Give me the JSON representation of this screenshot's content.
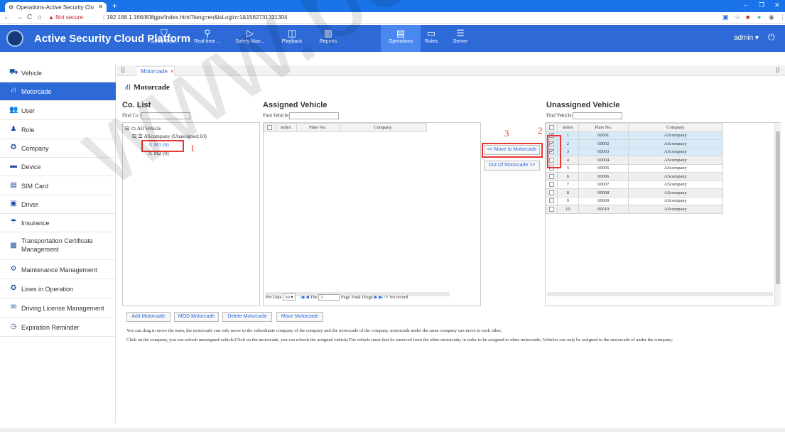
{
  "browser": {
    "tab_title": "Operations-Active Security Clo",
    "security_label": "Not secure",
    "url": "192.168.1.166/808gps/index.html?lang=en&isLogin=1&1562731331304"
  },
  "app": {
    "title": "Active Security Cloud Platform",
    "user": "admin",
    "accent": "#2d6ad8",
    "nav_tabs": [
      {
        "label": "Safety Boa...",
        "icon": "shield-icon"
      },
      {
        "label": "Real-time ...",
        "icon": "location-pin-icon"
      },
      {
        "label": "Safety Man...",
        "icon": "play-shield-icon"
      },
      {
        "label": "Playback",
        "icon": "playback-icon"
      },
      {
        "label": "Reports",
        "icon": "bar-chart-icon"
      },
      {
        "label": "Operations",
        "icon": "operations-icon"
      },
      {
        "label": "Rules",
        "icon": "rules-icon"
      },
      {
        "label": "Server",
        "icon": "server-icon"
      }
    ]
  },
  "sidebar": {
    "items": [
      {
        "label": "Vehicle"
      },
      {
        "label": "Motorcade"
      },
      {
        "label": "User"
      },
      {
        "label": "Role"
      },
      {
        "label": "Company"
      },
      {
        "label": "Device"
      },
      {
        "label": "SIM Card"
      },
      {
        "label": "Driver"
      },
      {
        "label": "Insurance"
      },
      {
        "label": "Transportation Certificate Management"
      },
      {
        "label": "Maintenance Management"
      },
      {
        "label": "Lines in Operation"
      },
      {
        "label": "Driving License Management"
      },
      {
        "label": "Expiration Reminder"
      }
    ]
  },
  "page_tab": {
    "label": "Motorcade",
    "close": "×"
  },
  "page_heading": "Motorcade",
  "co_list": {
    "title": "Co. List",
    "find_label": "Find Co.:",
    "tree": {
      "root": "All Vehicle",
      "company": "AScompany (Unassigned:10)",
      "m1": "M1 (0)",
      "m2": "M2 (0)"
    }
  },
  "assigned": {
    "title": "Assigned Vehicle",
    "find_label": "Find Vehicle:",
    "columns": [
      "Index",
      "Plate No.",
      "Company"
    ],
    "pager": {
      "per_data_label": "Per Data",
      "per_data_value": "50",
      "the_label": "The",
      "page_value": "1",
      "page_total": "Page Total 1Page",
      "status": "No record"
    }
  },
  "actions": {
    "move_to": "<< Move to Motorcade",
    "out_of": "Out Of Motorcade >>"
  },
  "unassigned": {
    "title": "Unassigned Vehicle",
    "find_label": "Find Vehicle:",
    "columns": [
      "Index",
      "Plate No.",
      "Company"
    ],
    "rows": [
      {
        "index": "1",
        "plate": "60001",
        "company": "AScompany",
        "checked": true
      },
      {
        "index": "2",
        "plate": "60002",
        "company": "AScompany",
        "checked": true
      },
      {
        "index": "3",
        "plate": "60003",
        "company": "AScompany",
        "checked": true
      },
      {
        "index": "4",
        "plate": "60004",
        "company": "AScompany",
        "checked": false
      },
      {
        "index": "5",
        "plate": "60005",
        "company": "AScompany",
        "checked": false
      },
      {
        "index": "6",
        "plate": "60006",
        "company": "AScompany",
        "checked": false
      },
      {
        "index": "7",
        "plate": "60007",
        "company": "AScompany",
        "checked": false
      },
      {
        "index": "8",
        "plate": "60008",
        "company": "AScompany",
        "checked": false
      },
      {
        "index": "9",
        "plate": "60009",
        "company": "AScompany",
        "checked": false
      },
      {
        "index": "10",
        "plate": "60010",
        "company": "AScompany",
        "checked": false
      }
    ]
  },
  "buttons": {
    "add": "Add Motorcade",
    "mod": "MOD Motorcade",
    "delete": "Delete Motorcade",
    "move": "Move Motorcade"
  },
  "annotations": {
    "step1": "1",
    "step2": "2",
    "step3": "3",
    "color": "#e53935"
  },
  "notes": {
    "line1": "You can drag to move the team, the motorcade can only move to the subordinate company of the company and the motorcade of the company, motorcade under the same company can move to each other;",
    "line2": "Click on the company, you can refresh unassigned vehicle;Click on the motorcade, you can refresh the assigned vehicle;The vehicle must first be removed from the other motorcade, in order to be assigned to other motorcade; Vehicles can only be assigned to the motorcade of under the company;"
  },
  "watermark": "www.bezpeka.c"
}
